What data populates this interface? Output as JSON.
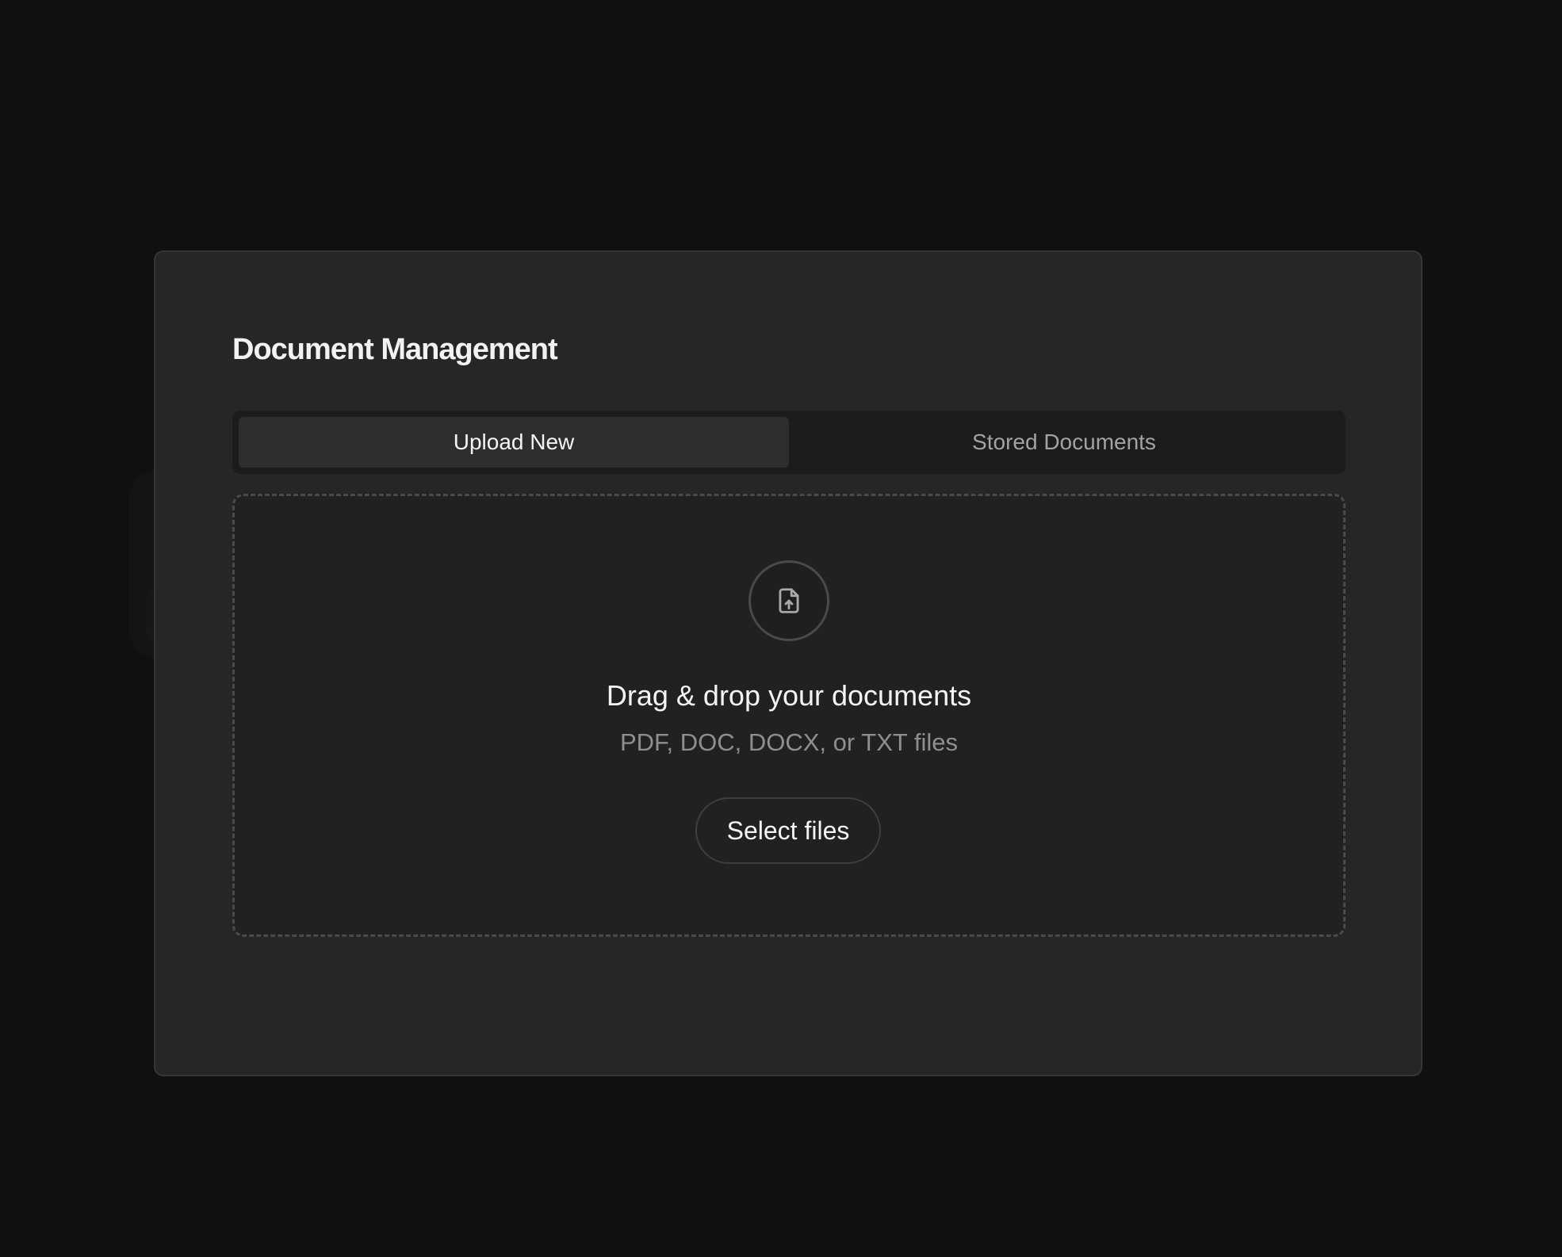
{
  "modal": {
    "title": "Document Management"
  },
  "tabs": [
    {
      "label": "Upload New",
      "active": true
    },
    {
      "label": "Stored Documents",
      "active": false
    }
  ],
  "dropzone": {
    "icon": "file-upload-icon",
    "title": "Drag & drop your documents",
    "subtitle": "PDF, DOC, DOCX, or TXT files",
    "button_label": "Select files"
  },
  "colors": {
    "page_background": "#101010",
    "modal_background": "#262626",
    "tab_active": "#2e2e2e",
    "text_primary": "#f4f4f4",
    "text_secondary": "#8e8e93"
  }
}
